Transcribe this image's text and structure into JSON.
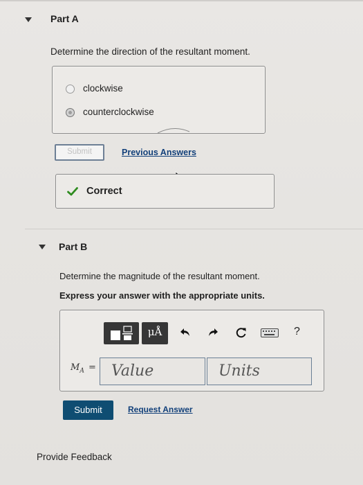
{
  "part_a": {
    "title": "Part A",
    "question": "Determine the direction of the resultant moment.",
    "options": [
      {
        "label": "clockwise",
        "selected": false
      },
      {
        "label": "counterclockwise",
        "selected": true
      }
    ],
    "submit_label": "Submit",
    "previous_answers_label": "Previous Answers",
    "result_label": "Correct",
    "result_color": "#2e8b1f"
  },
  "part_b": {
    "title": "Part B",
    "question": "Determine the magnitude of the resultant moment.",
    "instruction": "Express your answer with the appropriate units.",
    "toolbar": {
      "templates_icon": "fraction-template-icon",
      "units_label": "μÅ",
      "undo_icon": "undo-icon",
      "redo_icon": "redo-icon",
      "reset_icon": "reset-icon",
      "keyboard_icon": "keyboard-icon",
      "help_label": "?"
    },
    "variable_label": "M",
    "variable_subscript": "A",
    "equals": "=",
    "value_placeholder": "Value",
    "units_placeholder": "Units",
    "submit_label": "Submit",
    "request_answer_label": "Request Answer"
  },
  "footer": {
    "provide_feedback_label": "Provide Feedback"
  }
}
